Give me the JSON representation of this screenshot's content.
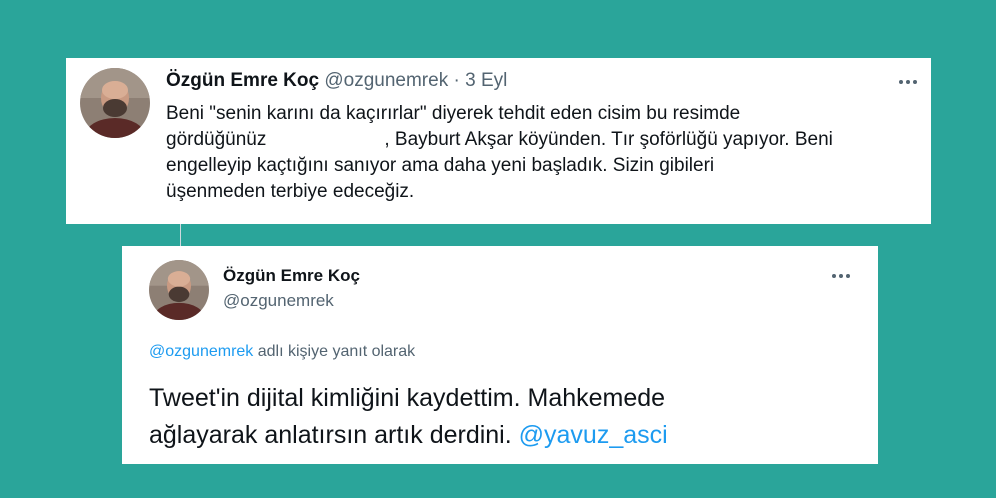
{
  "tweet1": {
    "author_name": "Özgün Emre Koç",
    "handle": "@ozgunemrek",
    "separator": "·",
    "date": "3 Eyl",
    "lines": [
      "Beni \"senin karını da kaçırırlar\" diyerek tehdit eden cisim bu resimde",
      ", Bayburt Akşar köyünden. Tır şoförlüğü yapıyor. Beni",
      "engelleyip kaçtığını sanıyor ama daha yeni başladık. Sizin gibileri",
      "üşenmeden terbiye edeceğiz."
    ],
    "line2_prefix": "gördüğünüz"
  },
  "tweet2": {
    "author_name": "Özgün Emre Koç",
    "handle": "@ozgunemrek",
    "reply_handle": "@ozgunemrek",
    "reply_suffix": "adlı kişiye yanıt olarak",
    "line1": "Tweet'in dijital kimliğini kaydettim. Mahkemede",
    "line2_text": "ağlayarak anlatırsın artık derdini.",
    "mention": "@yavuz_asci"
  },
  "colors": {
    "background": "#2aa59a",
    "link": "#1d9bf0",
    "text": "#0f1419",
    "secondary": "#536471"
  },
  "icons": {
    "more": "more-options-icon",
    "avatar": "avatar"
  }
}
